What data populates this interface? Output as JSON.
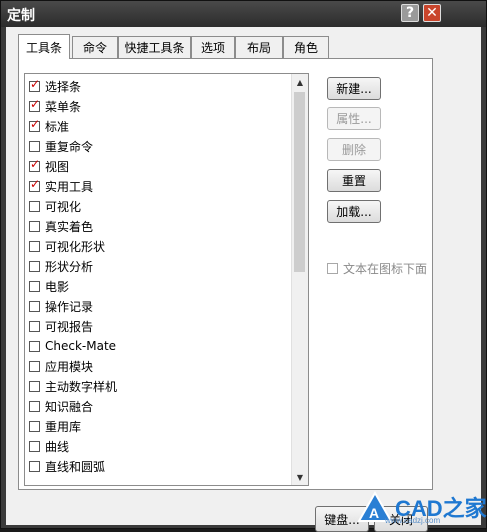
{
  "window": {
    "title": "定制"
  },
  "titlebar": {
    "help_glyph": "?",
    "close_glyph": "✕"
  },
  "tabs": [
    {
      "label": "工具条",
      "active": true
    },
    {
      "label": "命令",
      "active": false
    },
    {
      "label": "快捷工具条",
      "active": false
    },
    {
      "label": "选项",
      "active": false
    },
    {
      "label": "布局",
      "active": false
    },
    {
      "label": "角色",
      "active": false
    }
  ],
  "toolbars_list": {
    "items": [
      {
        "label": "选择条",
        "checked": true
      },
      {
        "label": "菜单条",
        "checked": true
      },
      {
        "label": "标准",
        "checked": true
      },
      {
        "label": "重复命令",
        "checked": false
      },
      {
        "label": "视图",
        "checked": true
      },
      {
        "label": "实用工具",
        "checked": true
      },
      {
        "label": "可视化",
        "checked": false
      },
      {
        "label": "真实着色",
        "checked": false
      },
      {
        "label": "可视化形状",
        "checked": false
      },
      {
        "label": "形状分析",
        "checked": false
      },
      {
        "label": "电影",
        "checked": false
      },
      {
        "label": "操作记录",
        "checked": false
      },
      {
        "label": "可视报告",
        "checked": false
      },
      {
        "label": "Check-Mate",
        "checked": false
      },
      {
        "label": "应用模块",
        "checked": false
      },
      {
        "label": "主动数字样机",
        "checked": false
      },
      {
        "label": "知识融合",
        "checked": false
      },
      {
        "label": "重用库",
        "checked": false
      },
      {
        "label": "曲线",
        "checked": false
      },
      {
        "label": "直线和圆弧",
        "checked": false
      }
    ]
  },
  "side_buttons": {
    "new": "新建...",
    "properties": "属性...",
    "delete": "删除",
    "reset": "重置",
    "load": "加载..."
  },
  "text_below_icon": {
    "label": "文本在图标下面",
    "checked": false
  },
  "bottom_buttons": {
    "keyboard": "键盘...",
    "close": "关闭"
  },
  "watermark": {
    "brand": "CAD之家",
    "url": "www.cadzj.com"
  },
  "colors": {
    "check_mark": "#cc0000",
    "brand_blue": "#1f78d1",
    "close_red": "#c9452c"
  }
}
